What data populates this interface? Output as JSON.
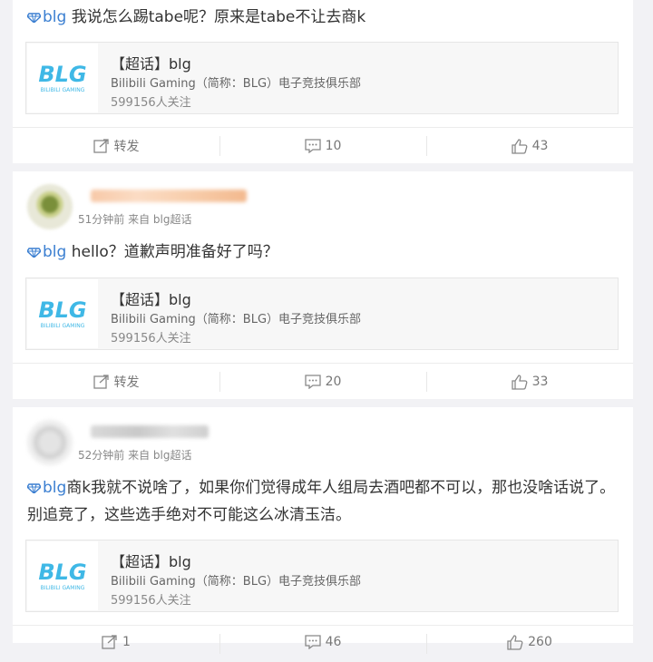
{
  "posts": [
    {
      "topic_tag": "blg",
      "text": "我说怎么踢tabe呢？原来是tabe不让去商k",
      "topic_card": {
        "title": "【超话】blg",
        "description": "Bilibili Gaming（简称：BLG）电子竞技俱乐部",
        "followers": "599156人关注",
        "logo_text": "BLG",
        "logo_subtext": "BILIBILI GAMING"
      },
      "actions": {
        "repost": "转发",
        "comments": "10",
        "likes": "43"
      }
    },
    {
      "meta": "51分钟前 来自 blg超话",
      "topic_tag": "blg",
      "text": "hello？道歉声明准备好了吗？",
      "topic_card": {
        "title": "【超话】blg",
        "description": "Bilibili Gaming（简称：BLG）电子竞技俱乐部",
        "followers": "599156人关注",
        "logo_text": "BLG",
        "logo_subtext": "BILIBILI GAMING"
      },
      "actions": {
        "repost": "转发",
        "comments": "20",
        "likes": "33"
      }
    },
    {
      "meta": "52分钟前 来自 blg超话",
      "topic_tag": "blg",
      "text": "商k我就不说啥了，如果你们觉得成年人组局去酒吧都不可以，那也没啥话说了。别追竞了，这些选手绝对不可能这么冰清玉洁。",
      "topic_card": {
        "title": "【超话】blg",
        "description": "Bilibili Gaming（简称：BLG）电子竞技俱乐部",
        "followers": "599156人关注",
        "logo_text": "BLG",
        "logo_subtext": "BILIBILI GAMING"
      },
      "actions": {
        "repost": "1",
        "comments": "46",
        "likes": "260"
      }
    }
  ],
  "colors": {
    "link": "#3b7fd1",
    "logo_blue": "#3fb8e6",
    "logo_pink": "#e8669a"
  }
}
